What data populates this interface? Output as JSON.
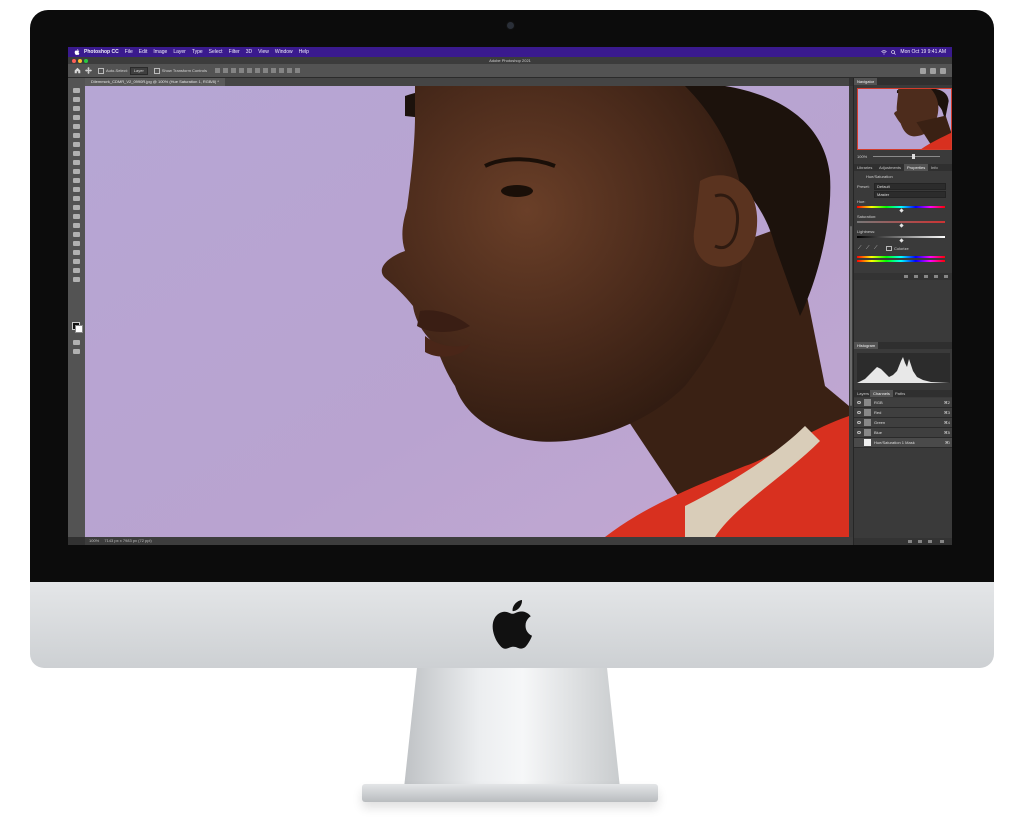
{
  "menubar": {
    "app_name": "Photoshop CC",
    "items": [
      "File",
      "Edit",
      "Image",
      "Layer",
      "Type",
      "Select",
      "Filter",
      "3D",
      "View",
      "Window",
      "Help"
    ],
    "clock": "Mon Oct 19  9:41 AM",
    "background_color": "#3a1a8e"
  },
  "window": {
    "title": "Adobe Photoshop 2021"
  },
  "options_bar": {
    "auto_select_label": "Auto-Select:",
    "auto_select_value": "Layer",
    "transform_controls_label": "Show Transform Controls"
  },
  "document": {
    "tab_label": "Dilemmcrk_CDMR_V2_0990R.jpg @ 100% (Hue Saturation 1, RGB/8) *",
    "status_zoom": "100%",
    "status_info": "7143 px x 7983 px (72 ppi)"
  },
  "navigator": {
    "tab_label": "Navigator",
    "zoom": "100%"
  },
  "properties": {
    "tabs": [
      "Libraries",
      "Adjustments",
      "Properties",
      "Info"
    ],
    "active_tab": "Properties",
    "layer_name": "Hue/Saturation",
    "preset_label": "Preset:",
    "preset_value": "Default",
    "channel_value": "Master",
    "hue_label": "Hue:",
    "saturation_label": "Saturation:",
    "lightness_label": "Lightness:",
    "colorize_label": "Colorize",
    "hue_value": 0,
    "saturation_value": 0,
    "lightness_value": 0
  },
  "histogram": {
    "tab_label": "Histogram"
  },
  "channels": {
    "tabs": [
      "Layers",
      "Channels",
      "Paths"
    ],
    "active_tab": "Channels",
    "rows": [
      {
        "name": "RGB",
        "key": "⌘2"
      },
      {
        "name": "Red",
        "key": "⌘3"
      },
      {
        "name": "Green",
        "key": "⌘4"
      },
      {
        "name": "Blue",
        "key": "⌘5"
      },
      {
        "name": "Hue/Saturation 1 Mask",
        "key": "⌘\\"
      }
    ]
  },
  "icons": {
    "apple": "apple-logo",
    "wifi": "wifi-icon",
    "search": "search-icon",
    "home": "home-icon",
    "move": "move-tool-icon"
  },
  "colors": {
    "backdrop": "#b7a4d2",
    "shirt": "#d8301f",
    "skin": "#4a2b1c"
  }
}
